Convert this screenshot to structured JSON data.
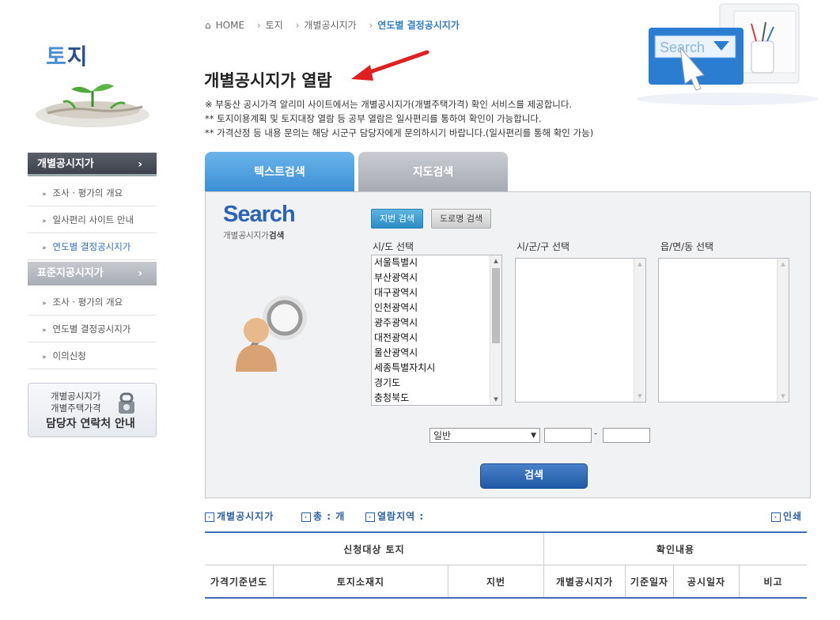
{
  "sidebar": {
    "title_accent": "토",
    "title_rest": "지",
    "categories": [
      {
        "label": "개별공시지가",
        "items": [
          "조사 · 평가의 개요",
          "일사편리 사이트 안내",
          "연도별 결정공시지가"
        ]
      },
      {
        "label": "표준지공시지가",
        "items": [
          "조사 · 평가의 개요",
          "연도별 결정공시지가",
          "이의신청"
        ]
      }
    ],
    "contact": {
      "line1": "개별공시지가",
      "line2": "개별주택가격",
      "line3": "담당자 연락처 안내"
    }
  },
  "breadcrumb": [
    "HOME",
    "토지",
    "개별공시지가",
    "연도별 결정공시지가"
  ],
  "page_title": "개별공시지가 열람",
  "descriptions": [
    "※ 부동산 공시가격 알리미 사이트에서는 개별공시지가(개별주택가격) 확인 서비스를 제공합니다.",
    "** 토지이용계획 및 토지대장 열람 등 공부 열람은 일사편리를 통하여 확인이 가능합니다.",
    "** 가격산정 등 내용 문의는 해당 시군구 담당자에게 문의하시기 바랍니다.(일사편리를 통해 확인 가능)"
  ],
  "deco_search_text": "Search",
  "tabs": [
    "텍스트검색",
    "지도검색"
  ],
  "search_panel": {
    "logo": "Search",
    "sub_normal": "개별공시지가",
    "sub_bold": "검색",
    "buttons": [
      "지번 검색",
      "도로명 검색"
    ],
    "labels": [
      "시/도 선택",
      "시/군/구 선택",
      "읍/면/동 선택"
    ],
    "sido_options": [
      "서울특별시",
      "부산광역시",
      "대구광역시",
      "인천광역시",
      "광주광역시",
      "대전광역시",
      "울산광역시",
      "세종특별자치시",
      "경기도",
      "충청북도"
    ],
    "land_kind": "일반",
    "dash": "-",
    "search_button": "검색"
  },
  "results": {
    "labels": [
      "개별공시지가",
      "총 : 개",
      "열람지역 :",
      "인쇄"
    ],
    "header_groups": [
      "신청대상 토지",
      "확인내용"
    ],
    "columns": [
      "가격기준년도",
      "토지소재지",
      "지번",
      "개별공시지가",
      "기준일자",
      "공시일자",
      "비고"
    ]
  },
  "colors": {
    "accent": "#3c8fd6",
    "dark_nav": "#3d424c",
    "link": "#2f7fc8",
    "arrow": "#e02020"
  }
}
